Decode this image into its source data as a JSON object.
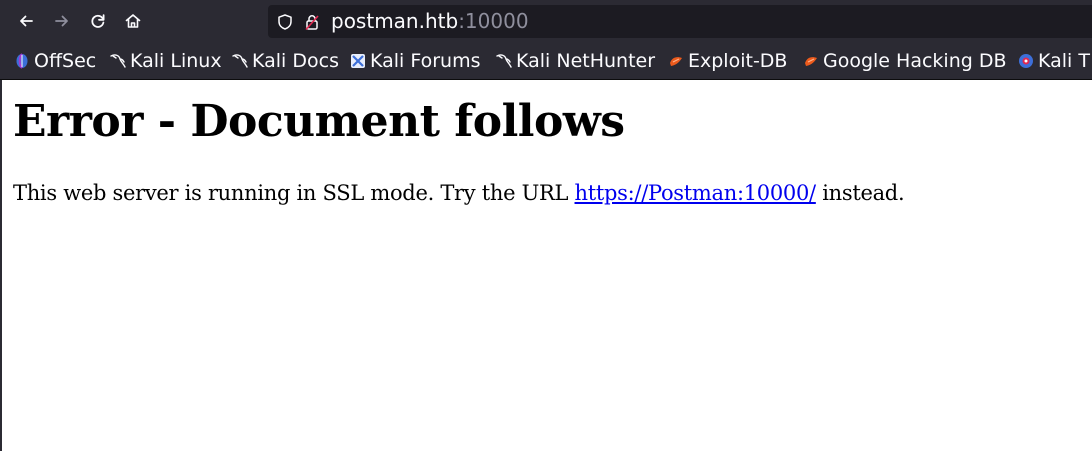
{
  "browser": {
    "url": {
      "host": "postman.htb",
      "port": ":10000"
    },
    "nav_icons": [
      "back-icon",
      "forward-icon",
      "reload-icon",
      "home-icon"
    ],
    "url_icons": [
      "shield-icon",
      "lock-icon"
    ]
  },
  "bookmarks": [
    {
      "label": "OffSec",
      "icon": "offsec-icon"
    },
    {
      "label": "Kali Linux",
      "icon": "kali-dragon-icon"
    },
    {
      "label": "Kali Docs",
      "icon": "kali-dragon-icon"
    },
    {
      "label": "Kali Forums",
      "icon": "kali-forums-icon"
    },
    {
      "label": "Kali NetHunter",
      "icon": "kali-dragon-icon"
    },
    {
      "label": "Exploit-DB",
      "icon": "exploit-db-icon"
    },
    {
      "label": "Google Hacking DB",
      "icon": "exploit-db-icon"
    },
    {
      "label": "Kali T",
      "icon": "kali-tools-icon"
    }
  ],
  "page": {
    "heading": "Error - Document follows",
    "message_before": "This web server is running in SSL mode. Try the URL ",
    "link_text": "https://Postman:10000/",
    "message_after": " instead."
  },
  "colors": {
    "toolbar_bg": "#2b2a33",
    "urlbar_bg": "#1c1b22",
    "link": "#0000ee",
    "port_text": "#8f8f9d"
  }
}
